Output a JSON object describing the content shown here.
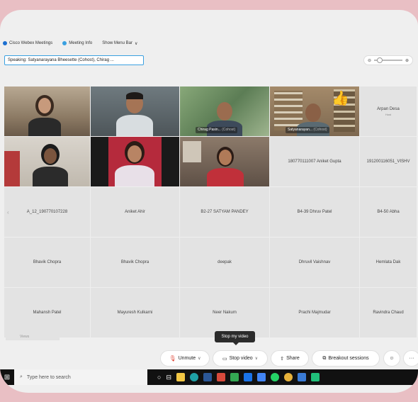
{
  "menubar": {
    "app": "Cisco Webex Meetings",
    "info": "Meeting Info",
    "show_menu": "Show Menu Bar"
  },
  "speaking": "Speaking: Satyanarayana Bheesette (Cohost), Chirag ...",
  "zoom": {
    "minus": "⊖",
    "plus": "⊕",
    "level": 0.1
  },
  "tiles": [
    {
      "id": "t1",
      "type": "video"
    },
    {
      "id": "t2",
      "type": "video"
    },
    {
      "id": "t3",
      "type": "video",
      "name": "Chirag Pasin...",
      "cohost": "(Cohost)"
    },
    {
      "id": "t4",
      "type": "video",
      "name": "Satyanarayan...",
      "cohost": "(Cohost)"
    },
    {
      "id": "t5",
      "type": "name",
      "name": "Arpan Desa",
      "sub": "Host"
    },
    {
      "id": "t6",
      "type": "video"
    },
    {
      "id": "t7",
      "type": "video"
    },
    {
      "id": "t8",
      "type": "video"
    },
    {
      "id": "t9",
      "type": "name",
      "name": "180770111007 Aniket Gupta"
    },
    {
      "id": "t10",
      "type": "name",
      "name": "191200116051_VISHV"
    },
    {
      "id": "t11",
      "type": "name",
      "name": "A_12_190770107228"
    },
    {
      "id": "t12",
      "type": "name",
      "name": "Aniket Ahir"
    },
    {
      "id": "t13",
      "type": "name",
      "name": "B2-27 SATYAM PANDEY"
    },
    {
      "id": "t14",
      "type": "name",
      "name": "B4-39 Dhruv Patel"
    },
    {
      "id": "t15",
      "type": "name",
      "name": "B4-50 Abha"
    },
    {
      "id": "t16",
      "type": "name",
      "name": "Bhavik Chopra"
    },
    {
      "id": "t17",
      "type": "name",
      "name": "Bhavik Chopra"
    },
    {
      "id": "t18",
      "type": "name",
      "name": "deepak"
    },
    {
      "id": "t19",
      "type": "name",
      "name": "Dhruvil Vaishnav"
    },
    {
      "id": "t20",
      "type": "name",
      "name": "Hemlata Dak"
    },
    {
      "id": "t21",
      "type": "name",
      "name": "Mahansh Patel"
    },
    {
      "id": "t22",
      "type": "name",
      "name": "Mayuresh Kulkarni"
    },
    {
      "id": "t23",
      "type": "name",
      "name": "Neer Nakum"
    },
    {
      "id": "t24",
      "type": "name",
      "name": "Prachi Majmudar"
    },
    {
      "id": "t25",
      "type": "name",
      "name": "Ravindra Chaud"
    }
  ],
  "tooltip": "Stop my video",
  "views": "Views",
  "controls": {
    "unmute": "Unmute",
    "stop_video": "Stop video",
    "share": "Share",
    "breakout": "Breakout sessions",
    "more": "···"
  },
  "taskbar": {
    "search_placeholder": "Type here to search"
  },
  "colors": {
    "accent": "#2aa0d8",
    "unmute_icon": "#e04a3b",
    "background": "#e9bfc4"
  }
}
